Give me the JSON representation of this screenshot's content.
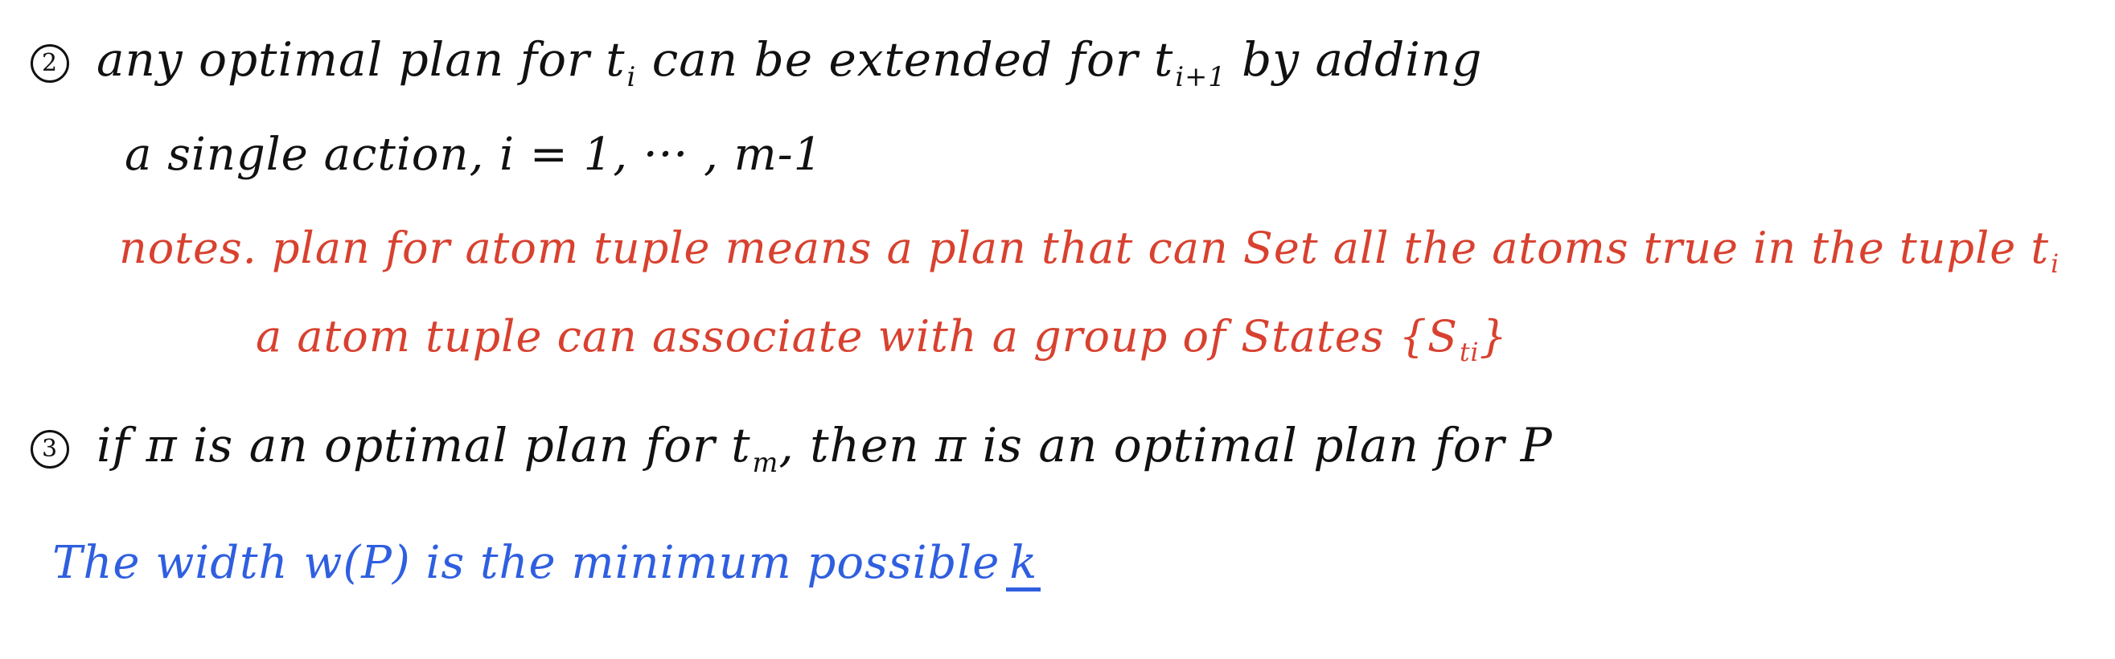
{
  "item2": {
    "number": "2",
    "line1_before_sub1": "any optimal plan for t",
    "sub1": "i",
    "line1_middle": " can be extended for t",
    "sub2": "i+1",
    "line1_after": " by adding",
    "line2": "a single action, i = 1, ··· , m-1"
  },
  "notes": {
    "line1_before": "notes. plan for atom tuple means a plan that can Set all the atoms true in the tuple t",
    "line1_sub": "i",
    "line2_before": "a atom tuple can associate with a group of States {S",
    "line2_sub": "ti",
    "line2_after": "}"
  },
  "item3": {
    "number": "3",
    "line_before": "if π is an optimal plan for t",
    "sub": "m",
    "line_after": ", then π is an optimal plan for P"
  },
  "width_statement": {
    "text": "The width w(P) is the minimum possible",
    "k": "k"
  },
  "colors": {
    "black": "#111111",
    "red": "#d8412f",
    "blue": "#2f5fe0"
  }
}
